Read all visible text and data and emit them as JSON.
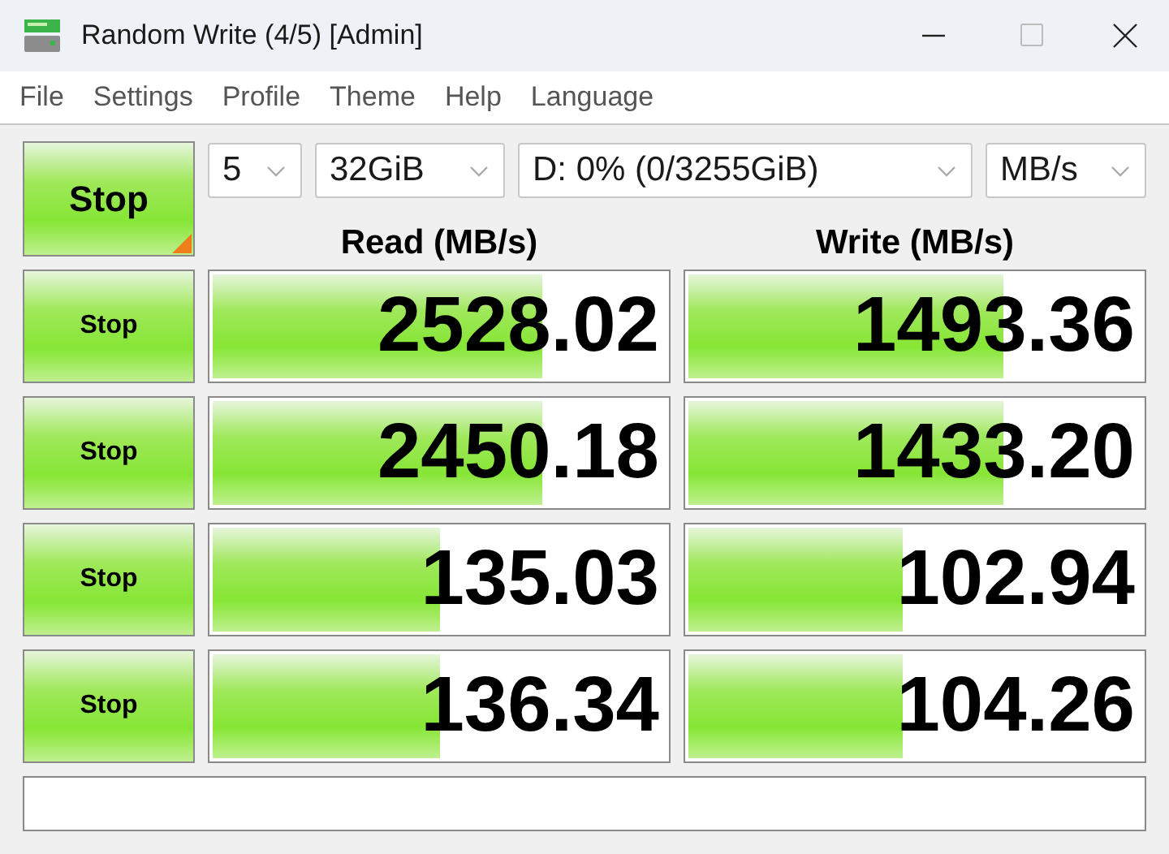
{
  "window": {
    "title": "Random Write (4/5) [Admin]"
  },
  "menu": [
    "File",
    "Settings",
    "Profile",
    "Theme",
    "Help",
    "Language"
  ],
  "toolbar": {
    "main_button": "Stop",
    "count": "5",
    "size": "32GiB",
    "drive": "D: 0% (0/3255GiB)",
    "unit": "MB/s"
  },
  "columns": [
    "Read (MB/s)",
    "Write (MB/s)"
  ],
  "rows": [
    {
      "button": "Stop",
      "read": {
        "value": "2528.02",
        "level": 0.73
      },
      "write": {
        "value": "1493.36",
        "level": 0.7
      }
    },
    {
      "button": "Stop",
      "read": {
        "value": "2450.18",
        "level": 0.73
      },
      "write": {
        "value": "1433.20",
        "level": 0.7
      }
    },
    {
      "button": "Stop",
      "read": {
        "value": "135.03",
        "level": 0.51
      },
      "write": {
        "value": "102.94",
        "level": 0.48
      }
    },
    {
      "button": "Stop",
      "read": {
        "value": "136.34",
        "level": 0.51
      },
      "write": {
        "value": "104.26",
        "level": 0.48
      }
    }
  ]
}
